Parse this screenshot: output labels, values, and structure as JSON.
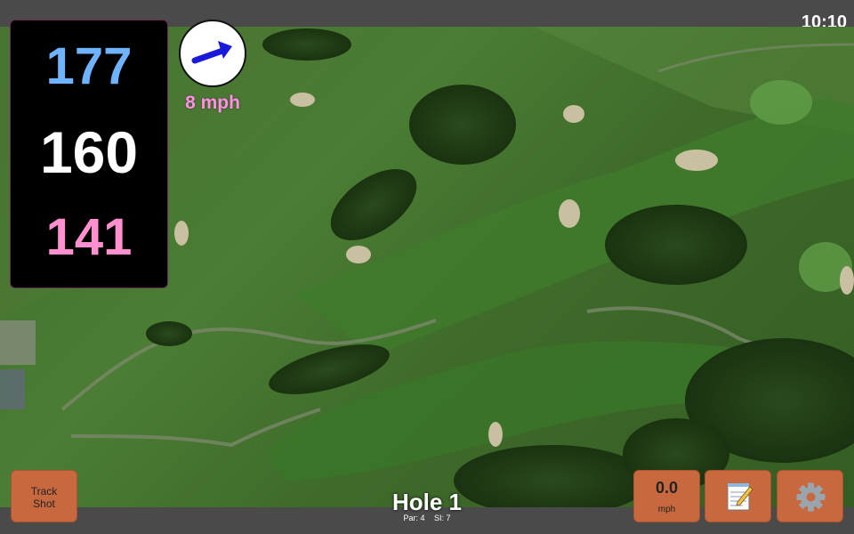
{
  "status_bar": {
    "time": "10:10"
  },
  "distances": {
    "back": "177",
    "middle": "160",
    "front": "141"
  },
  "wind": {
    "speed": "8 mph",
    "direction_icon": "arrow-icon",
    "arrow_color": "#1a1adb"
  },
  "colors": {
    "back": "#6fb3ff",
    "middle": "#ffffff",
    "front": "#ff8fcf",
    "button": "#c8683e"
  },
  "buttons": {
    "track_shot": {
      "line1": "Track",
      "line2": "Shot"
    },
    "wind": {
      "value": "0.0",
      "unit": "mph"
    },
    "notes_icon": "notepad-icon",
    "settings_icon": "gear-icon"
  },
  "hole": {
    "title": "Hole 1",
    "par": "Par: 4",
    "si": "SI: 7"
  }
}
